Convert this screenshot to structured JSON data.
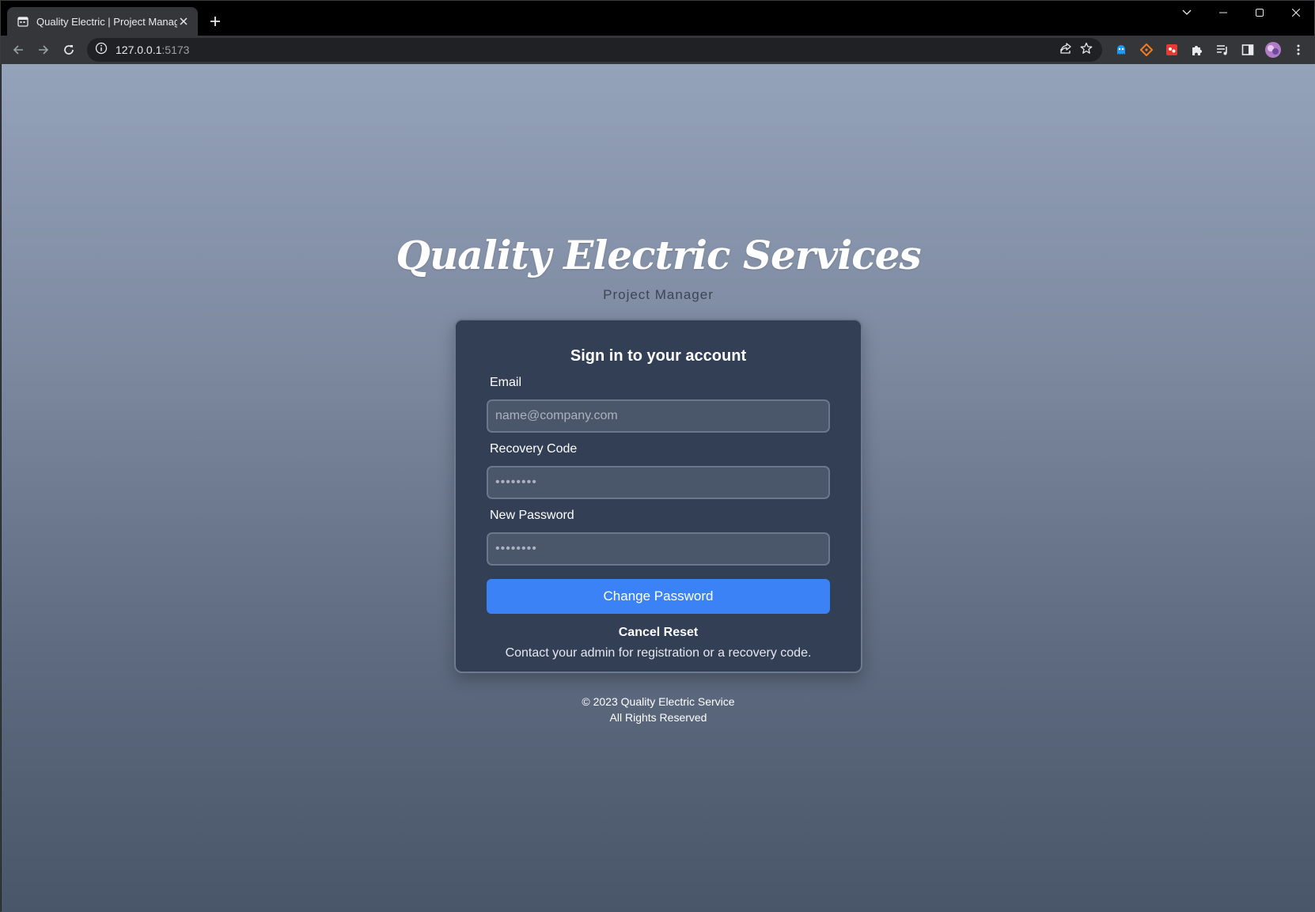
{
  "browser": {
    "tab_title": "Quality Electric | Project Manager",
    "url_host": "127.0.0.1",
    "url_port": ":5173"
  },
  "page": {
    "brand_title": "Quality Electric Services",
    "brand_subtitle": "Project Manager"
  },
  "form": {
    "heading": "Sign in to your account",
    "email_label": "Email",
    "email_placeholder": "name@company.com",
    "recovery_label": "Recovery Code",
    "recovery_placeholder": "••••••••",
    "new_password_label": "New Password",
    "new_password_placeholder": "••••••••",
    "submit_label": "Change Password",
    "cancel_label": "Cancel Reset",
    "contact_text": "Contact your admin for registration or a recovery code."
  },
  "footer": {
    "copyright": "© 2023 Quality Electric Service",
    "rights": "All Rights Reserved"
  },
  "colors": {
    "accent": "#3b82f6",
    "card_bg": "#323f55"
  }
}
